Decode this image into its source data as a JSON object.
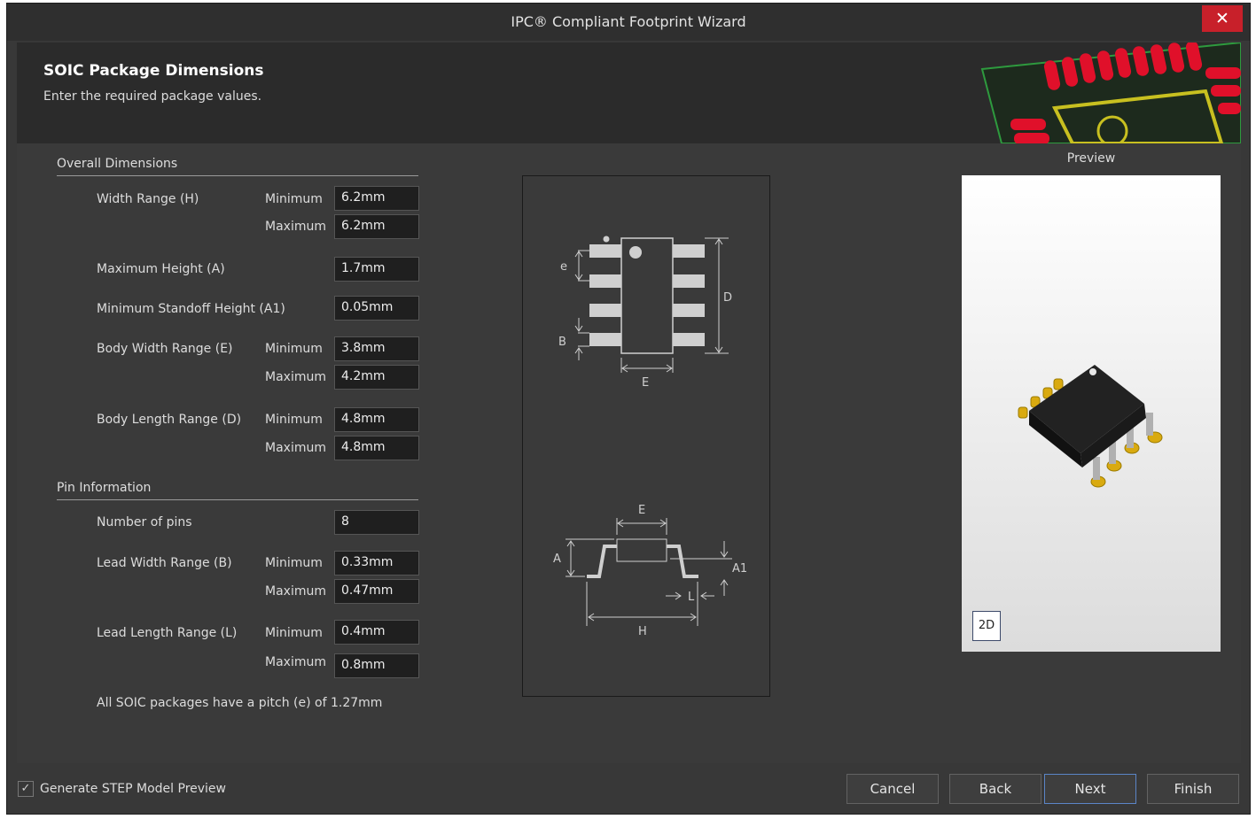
{
  "window": {
    "title": "IPC® Compliant Footprint Wizard",
    "close_symbol": "✕"
  },
  "header": {
    "title": "SOIC Package Dimensions",
    "subtitle": "Enter the required package values."
  },
  "overall": {
    "heading": "Overall Dimensions",
    "width_range": {
      "label": "Width Range (H)",
      "min_label": "Minimum",
      "min": "6.2mm",
      "max_label": "Maximum",
      "max": "6.2mm"
    },
    "max_height": {
      "label": "Maximum Height (A)",
      "value": "1.7mm"
    },
    "min_standoff": {
      "label": "Minimum Standoff Height (A1)",
      "value": "0.05mm"
    },
    "body_width": {
      "label": "Body Width Range (E)",
      "min_label": "Minimum",
      "min": "3.8mm",
      "max_label": "Maximum",
      "max": "4.2mm"
    },
    "body_length": {
      "label": "Body Length Range (D)",
      "min_label": "Minimum",
      "min": "4.8mm",
      "max_label": "Maximum",
      "max": "4.8mm"
    }
  },
  "pins": {
    "heading": "Pin Information",
    "count": {
      "label": "Number of pins",
      "value": "8"
    },
    "lead_width": {
      "label": "Lead Width Range (B)",
      "min_label": "Minimum",
      "min": "0.33mm",
      "max_label": "Maximum",
      "max": "0.47mm"
    },
    "lead_length": {
      "label": "Lead Length Range (L)",
      "min_label": "Minimum",
      "min": "0.4mm",
      "max_label": "Maximum",
      "max": "0.8mm"
    },
    "note": "All SOIC packages have a pitch (e) of 1.27mm"
  },
  "diagram": {
    "labels": {
      "e": "e",
      "b": "B",
      "d": "D",
      "e_top": "E",
      "e_side": "E",
      "a": "A",
      "a1": "A1",
      "l": "L",
      "h": "H"
    }
  },
  "preview": {
    "label": "Preview",
    "toggle_2d": "2D"
  },
  "footer": {
    "checkbox_checked": true,
    "checkbox_label": "Generate STEP Model Preview",
    "buttons": {
      "cancel": "Cancel",
      "back": "Back",
      "next": "Next",
      "finish": "Finish"
    }
  },
  "colors": {
    "accent_focus": "#5b85c7",
    "close": "#c8202a",
    "pcb_pad": "#e0102a",
    "pcb_silk": "#c8c020",
    "chip_lead": "#d4a800"
  }
}
